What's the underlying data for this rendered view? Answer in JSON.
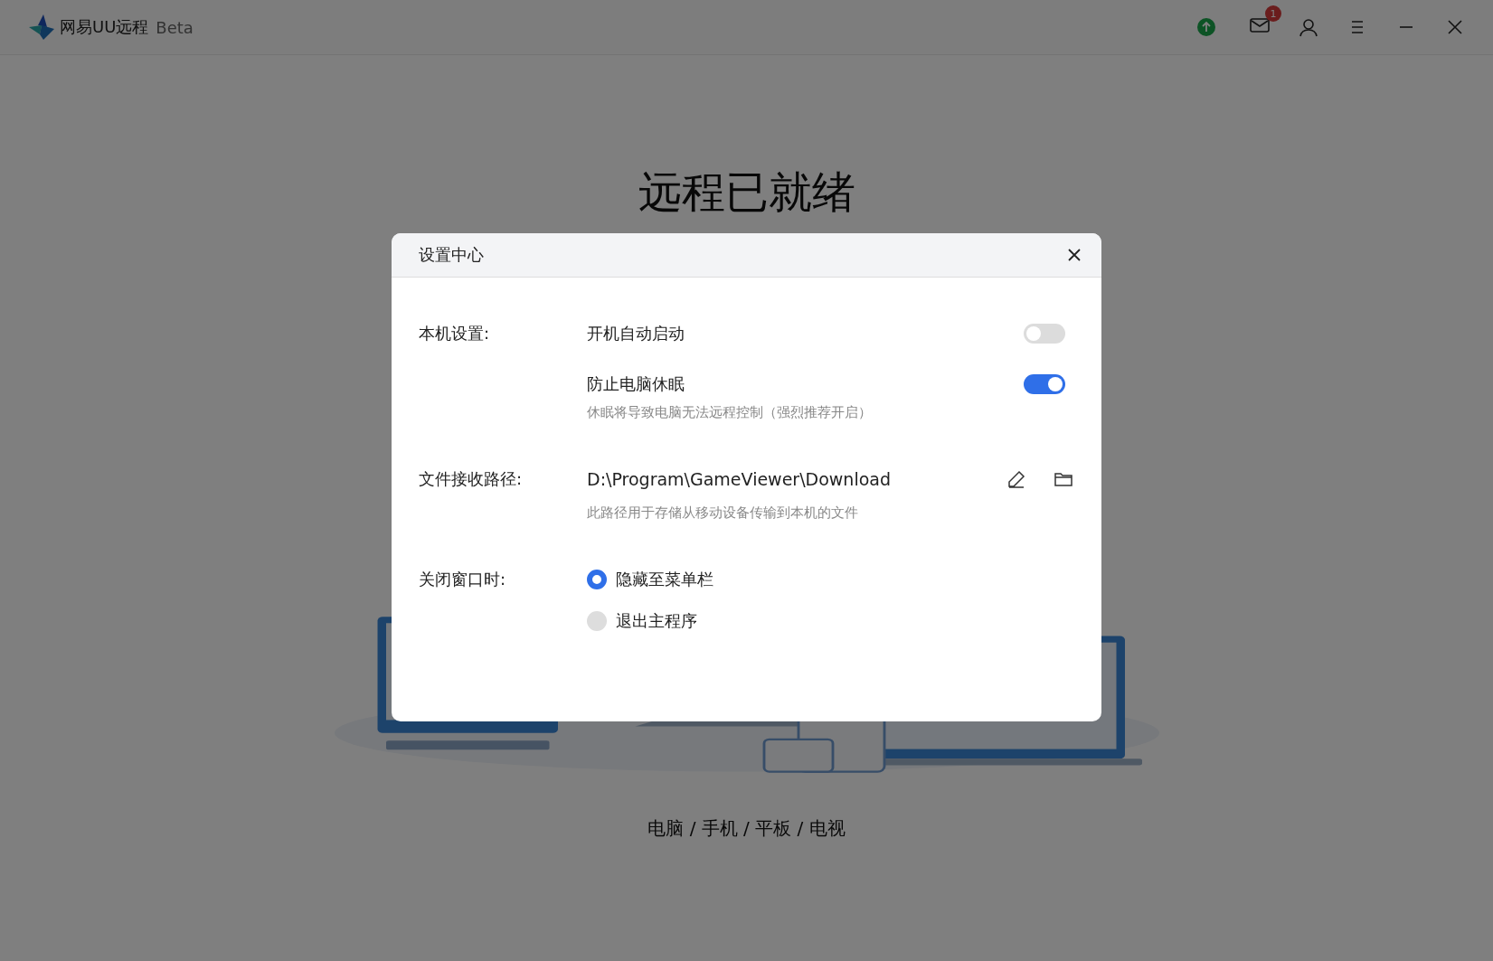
{
  "app": {
    "name": "网易UU远程",
    "badge": "Beta"
  },
  "toolbar": {
    "mail_count": "1"
  },
  "main": {
    "heading": "远程已就绪",
    "caption": "电脑 / 手机 / 平板 / 电视"
  },
  "dialog": {
    "title": "设置中心",
    "sections": [
      {
        "kind": "toggles",
        "label": "本机设置:",
        "items": [
          {
            "label": "开机自动启动",
            "on": false
          },
          {
            "label": "防止电脑休眠",
            "on": true,
            "description": "休眠将导致电脑无法远程控制（强烈推荐开启）"
          }
        ]
      },
      {
        "kind": "path",
        "label": "文件接收路径:",
        "value": "D:\\Program\\GameViewer\\Download",
        "description": "此路径用于存储从移动设备传输到本机的文件"
      },
      {
        "kind": "radio",
        "label": "关闭窗口时:",
        "options": [
          {
            "label": "隐藏至菜单栏",
            "selected": true
          },
          {
            "label": "退出主程序",
            "selected": false
          }
        ]
      }
    ]
  }
}
